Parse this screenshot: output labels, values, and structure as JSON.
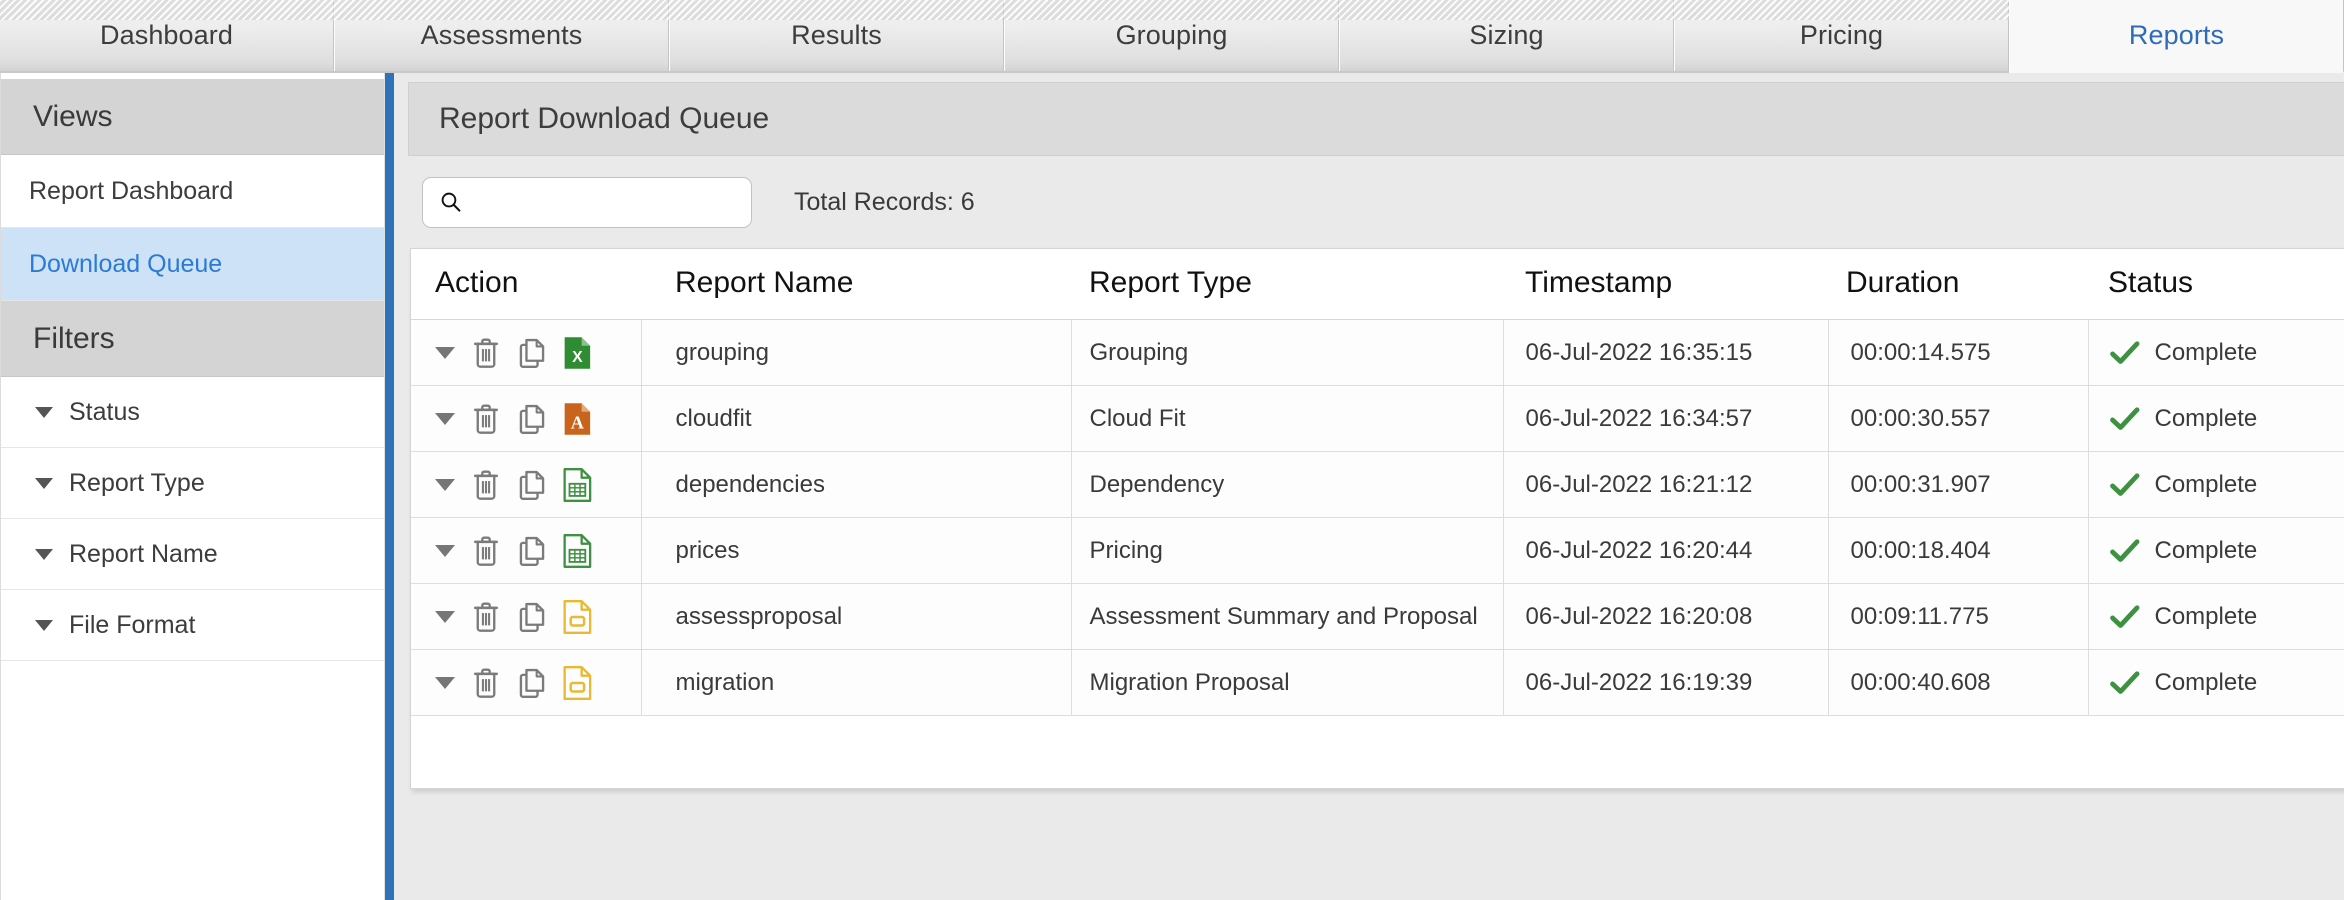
{
  "tabs": [
    {
      "label": "Dashboard",
      "active": false
    },
    {
      "label": "Assessments",
      "active": false
    },
    {
      "label": "Results",
      "active": false
    },
    {
      "label": "Grouping",
      "active": false
    },
    {
      "label": "Sizing",
      "active": false
    },
    {
      "label": "Pricing",
      "active": false
    },
    {
      "label": "Reports",
      "active": true
    }
  ],
  "sidebar": {
    "views_header": "Views",
    "views": [
      {
        "label": "Report Dashboard",
        "selected": false
      },
      {
        "label": "Download Queue",
        "selected": true
      }
    ],
    "filters_header": "Filters",
    "filters": [
      {
        "label": "Status"
      },
      {
        "label": "Report Type"
      },
      {
        "label": "Report Name"
      },
      {
        "label": "File Format"
      }
    ]
  },
  "panel": {
    "title": "Report Download Queue",
    "search": {
      "value": "",
      "placeholder": ""
    },
    "total_records": "Total Records: 6"
  },
  "table": {
    "columns": [
      "Action",
      "Report Name",
      "Report Type",
      "Timestamp",
      "Duration",
      "Status"
    ],
    "rows": [
      {
        "report_name": "grouping",
        "report_type": "Grouping",
        "timestamp": "06-Jul-2022 16:35:15",
        "duration": "00:00:14.575",
        "status": "Complete",
        "file_format": "xlsx"
      },
      {
        "report_name": "cloudfit",
        "report_type": "Cloud Fit",
        "timestamp": "06-Jul-2022 16:34:57",
        "duration": "00:00:30.557",
        "status": "Complete",
        "file_format": "pdf"
      },
      {
        "report_name": "dependencies",
        "report_type": "Dependency",
        "timestamp": "06-Jul-2022 16:21:12",
        "duration": "00:00:31.907",
        "status": "Complete",
        "file_format": "csv"
      },
      {
        "report_name": "prices",
        "report_type": "Pricing",
        "timestamp": "06-Jul-2022 16:20:44",
        "duration": "00:00:18.404",
        "status": "Complete",
        "file_format": "csv"
      },
      {
        "report_name": "assessproposal",
        "report_type": "Assessment Summary and Proposal",
        "timestamp": "06-Jul-2022 16:20:08",
        "duration": "00:09:11.775",
        "status": "Complete",
        "file_format": "pptx"
      },
      {
        "report_name": "migration",
        "report_type": "Migration Proposal",
        "timestamp": "06-Jul-2022 16:19:39",
        "duration": "00:00:40.608",
        "status": "Complete",
        "file_format": "pptx"
      }
    ]
  },
  "icons": {
    "expand": "chevron-down-icon",
    "delete": "trash-icon",
    "copy": "copy-icon",
    "search": "search-icon",
    "status": "check-icon"
  },
  "colors": {
    "accent_blue": "#2f72b8",
    "active_tab_text": "#2f6cb5",
    "selected_row": "#cde2f7",
    "status_green": "#3f9142",
    "excel_green": "#2f8c33",
    "pdf_orange": "#c9641c",
    "csv_green": "#3f9142",
    "ppt_yellow": "#e8b931"
  }
}
